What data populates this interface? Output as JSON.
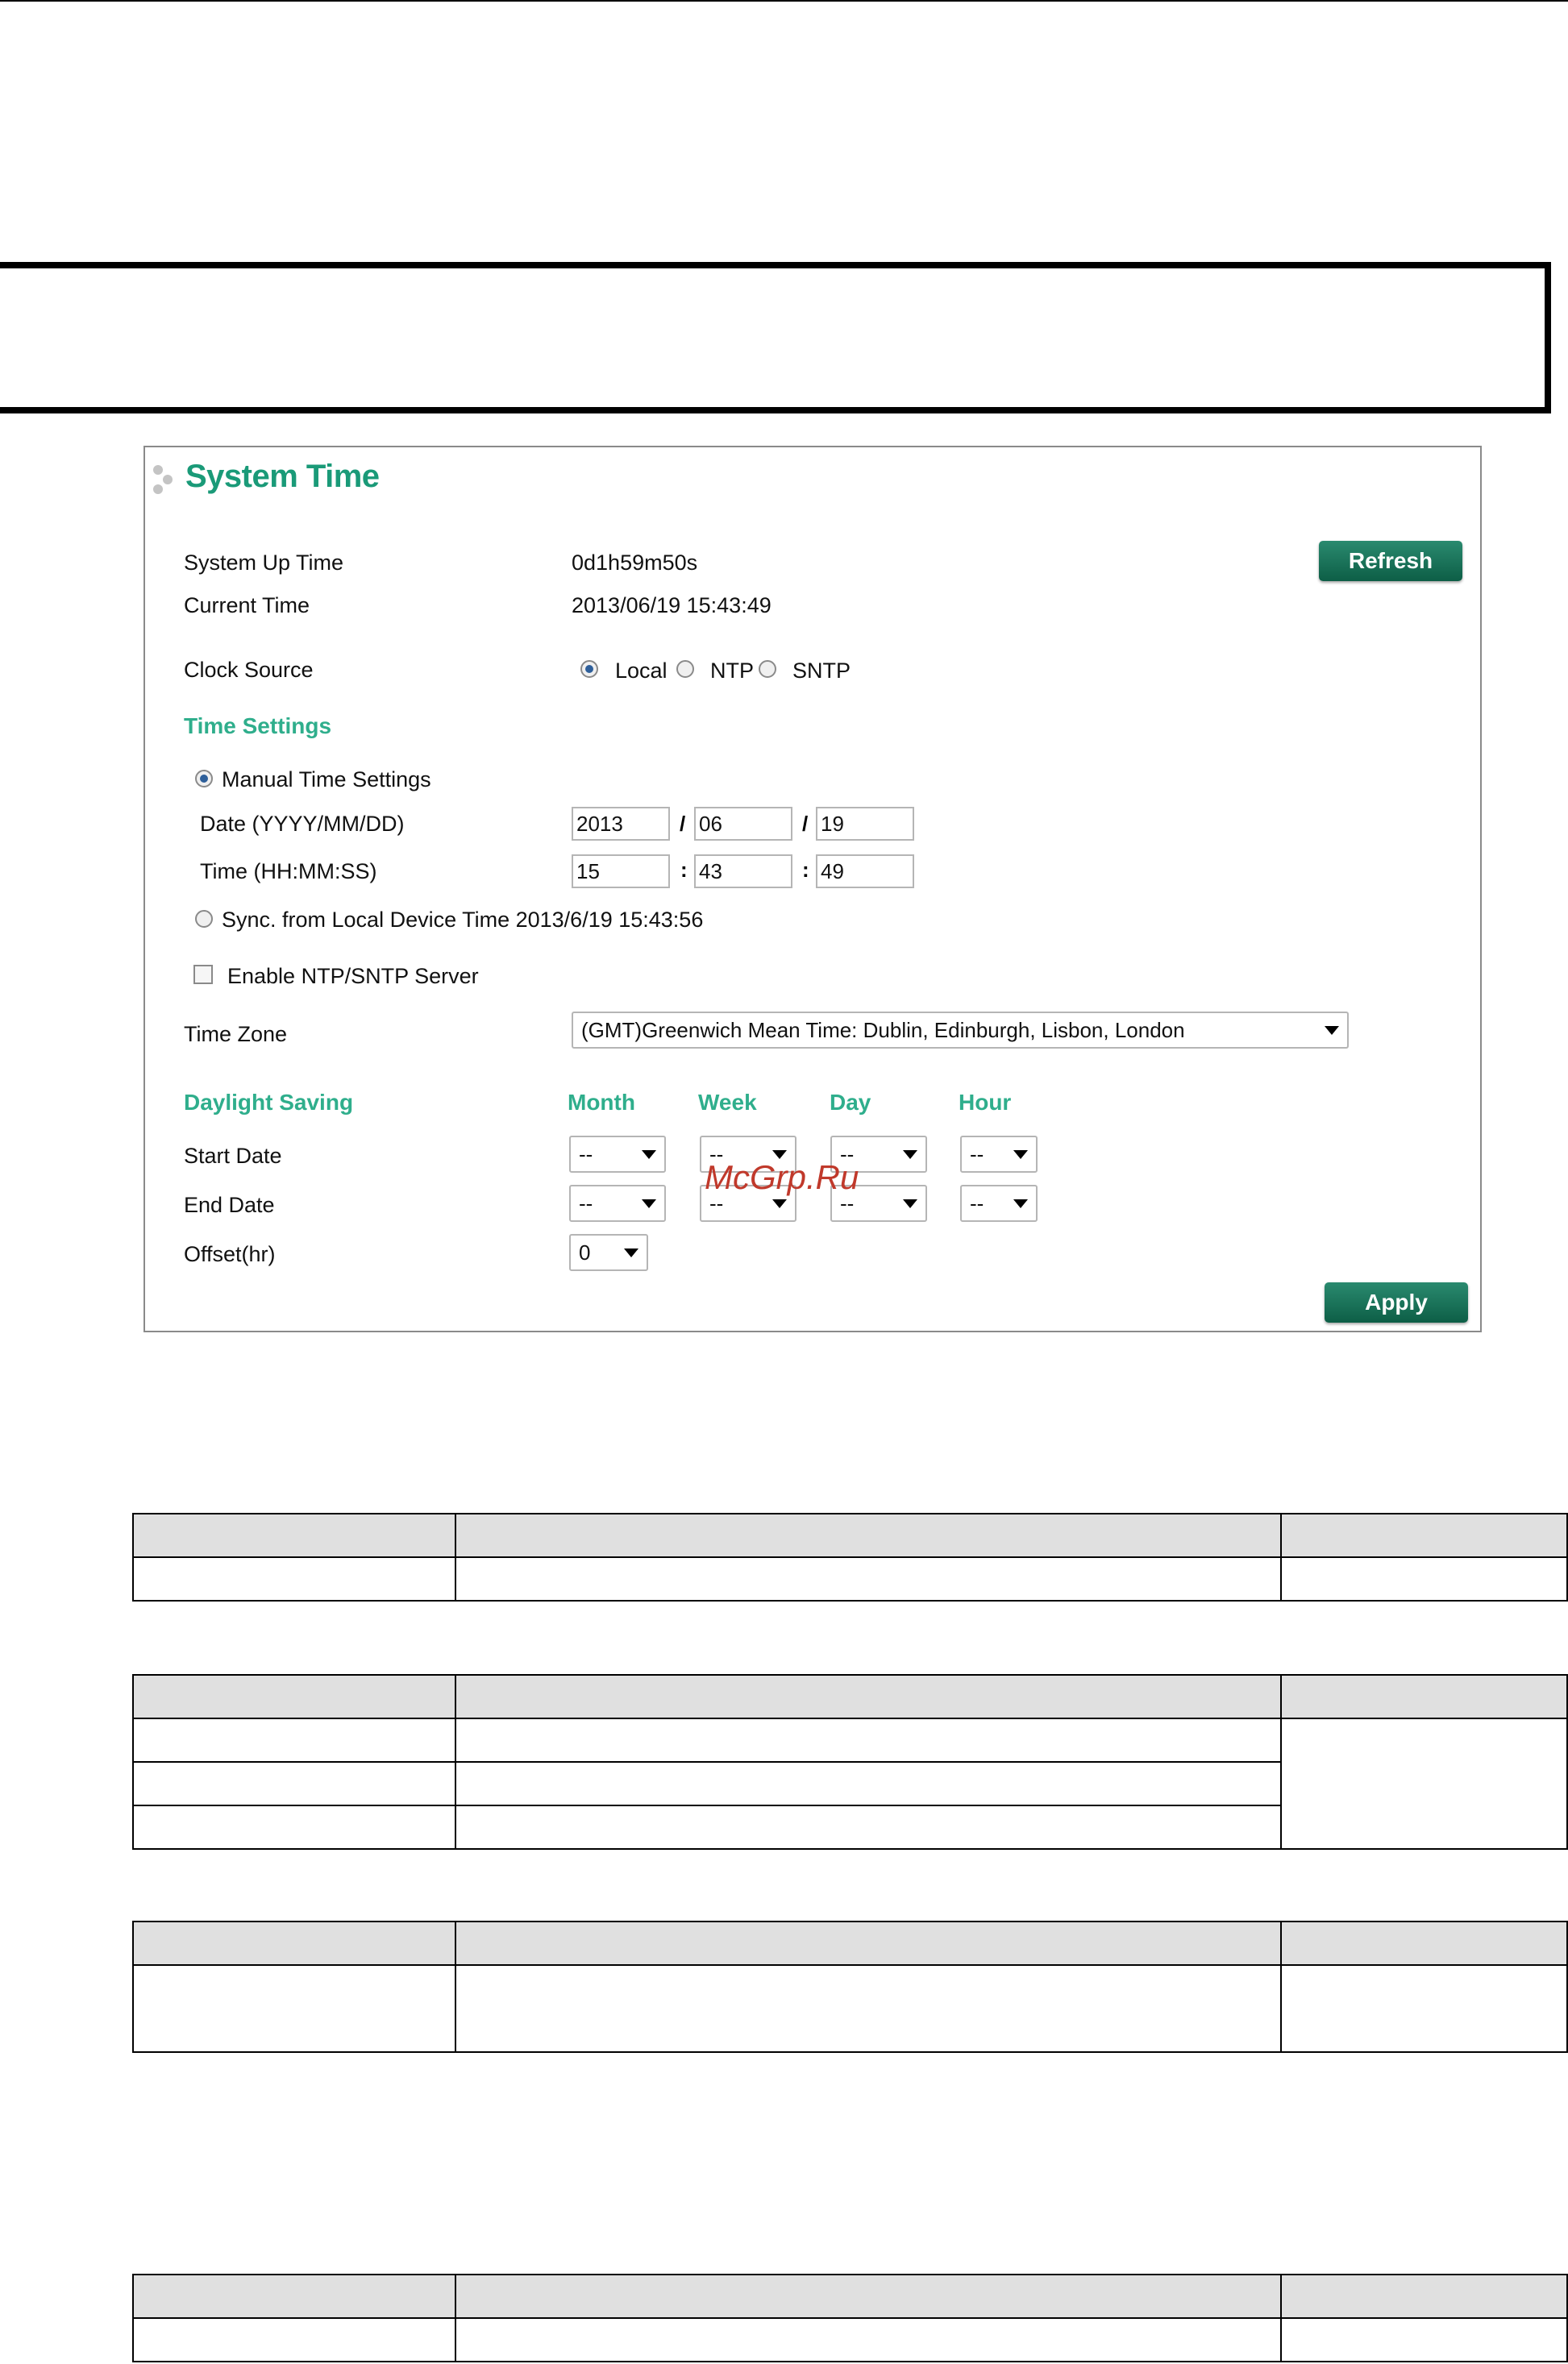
{
  "panel": {
    "title": "System Time",
    "refresh_label": "Refresh",
    "apply_label": "Apply",
    "system_up_time_label": "System Up Time",
    "system_up_time_value": "0d1h59m50s",
    "current_time_label": "Current Time",
    "current_time_value": "2013/06/19 15:43:49",
    "clock_source_label": "Clock Source",
    "clock_source_options": [
      "Local",
      "NTP",
      "SNTP"
    ],
    "clock_source_selected": "Local",
    "time_settings_heading": "Time Settings",
    "manual_time_label": "Manual Time Settings",
    "date_label": "Date (YYYY/MM/DD)",
    "date_year": "2013",
    "date_month": "06",
    "date_day": "19",
    "date_sep": "/",
    "time_label": "Time (HH:MM:SS)",
    "time_hour": "15",
    "time_minute": "43",
    "time_second": "49",
    "time_sep": ":",
    "sync_label": "Sync. from Local Device Time 2013/6/19 15:43:56",
    "enable_server_label": "Enable NTP/SNTP Server",
    "enable_server_checked": false,
    "time_zone_label": "Time Zone",
    "time_zone_value": "(GMT)Greenwich Mean Time: Dublin, Edinburgh, Lisbon, London",
    "daylight_saving_heading": "Daylight Saving",
    "dst_columns": [
      "Month",
      "Week",
      "Day",
      "Hour"
    ],
    "start_date_label": "Start Date",
    "end_date_label": "End Date",
    "offset_label": "Offset(hr)",
    "dst_placeholder": "--",
    "offset_value": "0"
  },
  "watermark": "McGrp.Ru",
  "colors": {
    "heading_green": "#2fae8c",
    "button_green": "#0d5e46",
    "table_header_gray": "#e0e0e0"
  }
}
